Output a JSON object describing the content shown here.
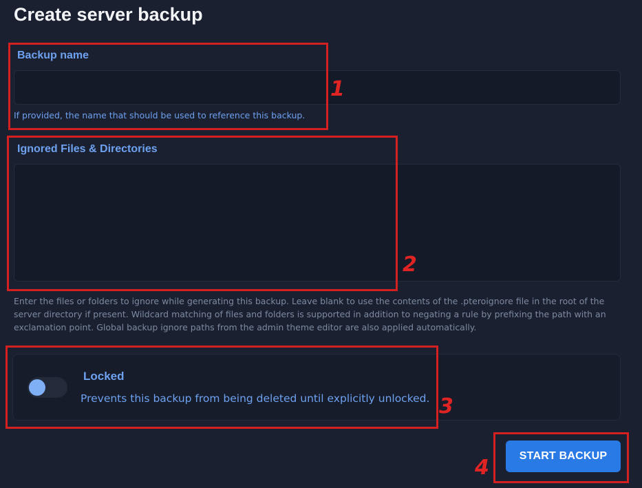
{
  "page": {
    "title": "Create server backup"
  },
  "backup_name": {
    "label": "Backup name",
    "value": "",
    "help": "If provided, the name that should be used to reference this backup."
  },
  "ignored": {
    "label": "Ignored Files & Directories",
    "value": "",
    "help": "Enter the files or folders to ignore while generating this backup. Leave blank to use the contents of the .pteroignore file in the root of the server directory if present. Wildcard matching of files and folders is supported in addition to negating a rule by prefixing the path with an exclamation point. Global backup ignore paths from the admin theme editor are also applied automatically."
  },
  "locked": {
    "label": "Locked",
    "description": "Prevents this backup from being deleted until explicitly unlocked.",
    "enabled": false
  },
  "actions": {
    "start_label": "START BACKUP"
  },
  "annotations": [
    "1",
    "2",
    "3",
    "4"
  ],
  "colors": {
    "background": "#1a2030",
    "accent": "#6ea1f0",
    "button": "#2a7ae6",
    "annotation": "#d42020"
  }
}
